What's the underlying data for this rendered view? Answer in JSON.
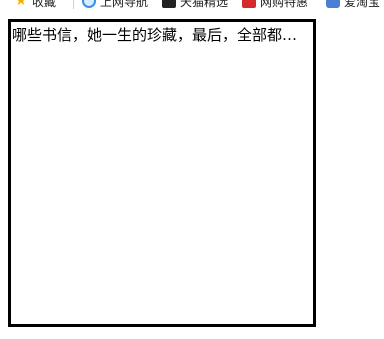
{
  "bookmarks": {
    "items": [
      {
        "icon": "star-icon",
        "label": "收藏"
      },
      {
        "icon": "browser-circle-icon",
        "label": "上网导航"
      },
      {
        "icon": "dark-square-icon",
        "label": "天猫精选"
      },
      {
        "icon": "red-square-icon",
        "label": "网购特惠"
      },
      {
        "icon": "blue-rounded-icon",
        "label": "爱淘宝"
      }
    ]
  },
  "content": {
    "truncated_text": "哪些书信，她一生的珍藏，最后，全部都交给了我，我一封一封地读完了"
  },
  "colors": {
    "border": "#000000",
    "background": "#ffffff",
    "star": "#f0b400"
  }
}
